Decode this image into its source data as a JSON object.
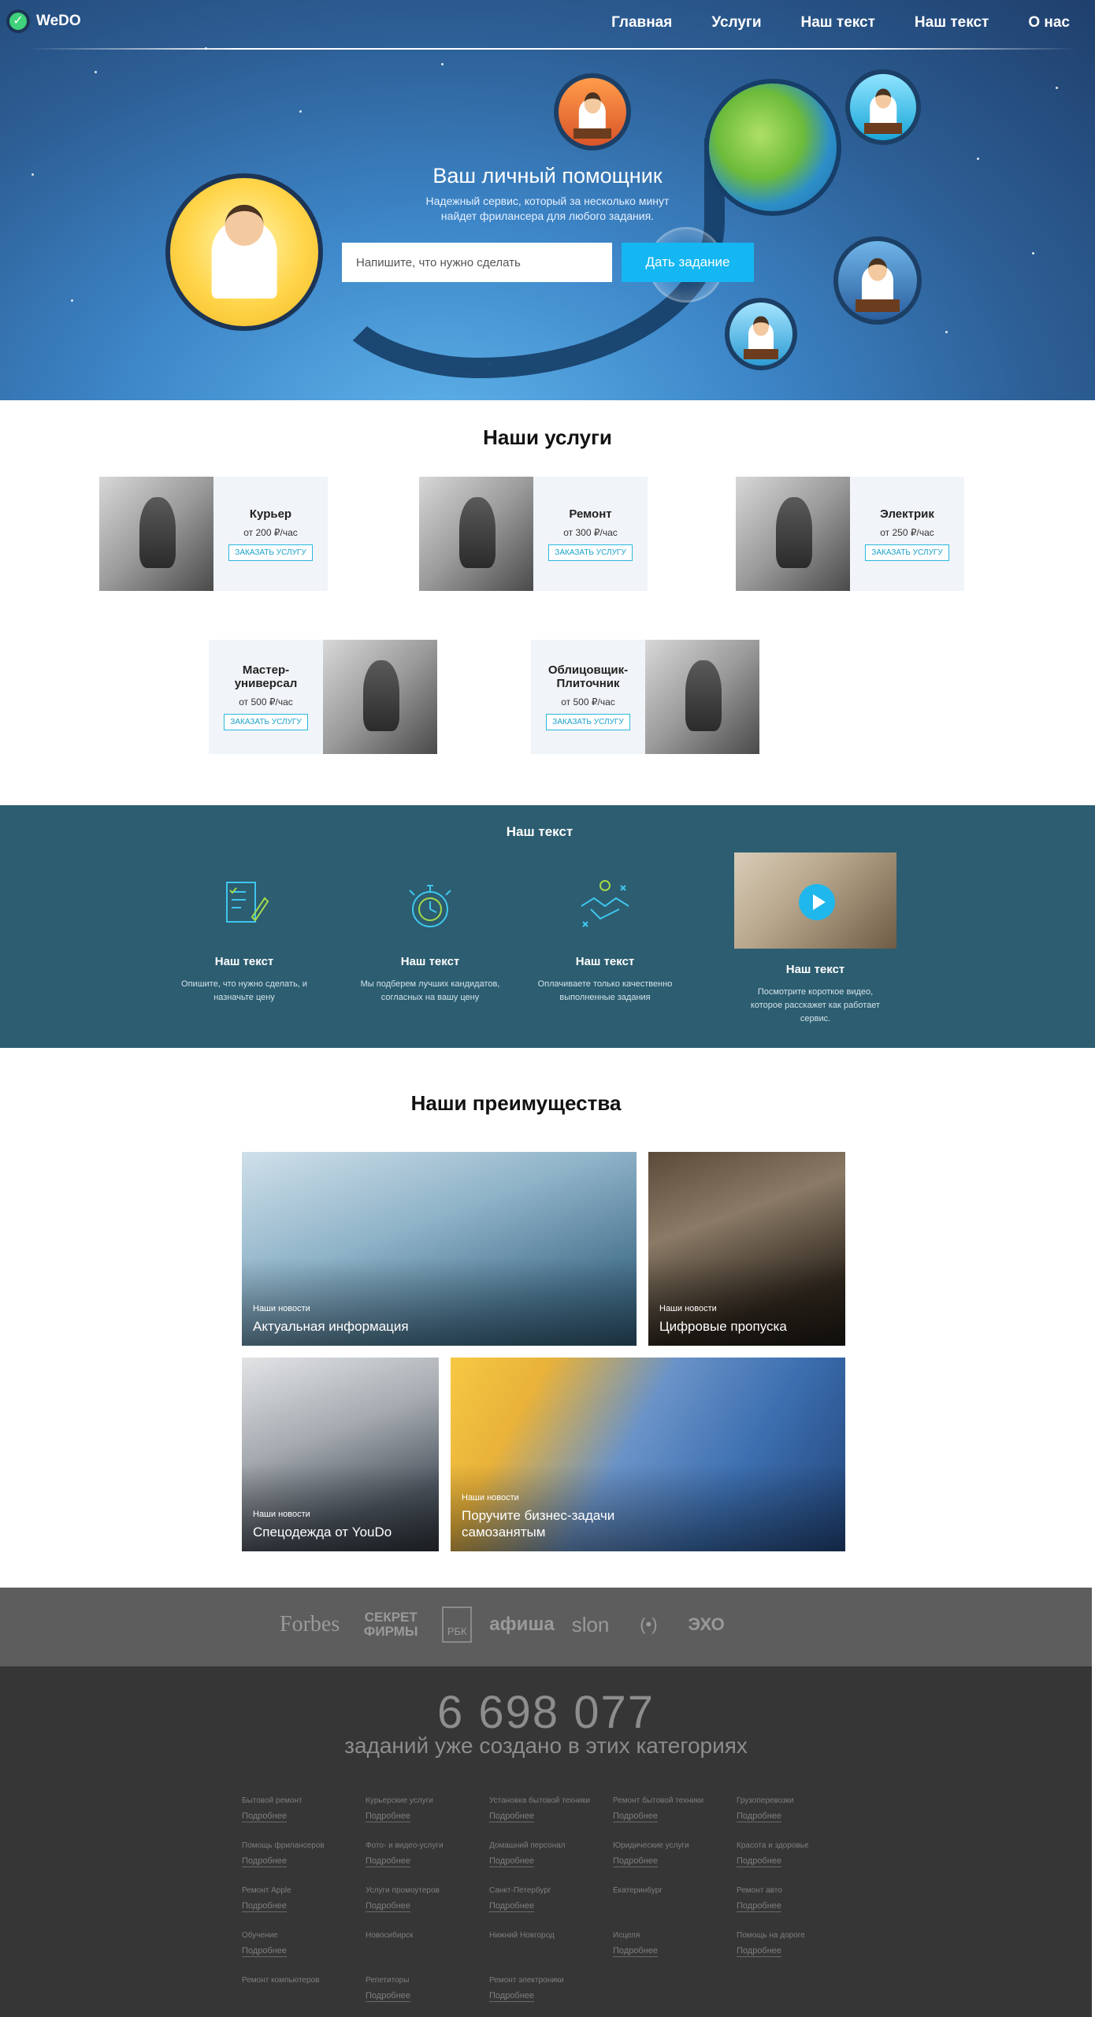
{
  "brand": {
    "name": "WeDO"
  },
  "nav": {
    "items": [
      "Главная",
      "Услуги",
      "Наш текст",
      "Наш текст",
      "О нас"
    ]
  },
  "hero": {
    "title": "Ваш личный помощник",
    "subtitle": "Надежный сервис, который за несколько минут найдет фрилансера для любого задания.",
    "input_placeholder": "Напишите, что нужно сделать",
    "button_label": "Дать задание"
  },
  "services": {
    "title": "Наши услуги",
    "order_label": "ЗАКАЗАТЬ УСЛУГУ",
    "items": [
      {
        "name": "Курьер",
        "price": "от 200 ₽/час",
        "icon": "courier-photo"
      },
      {
        "name": "Ремонт",
        "price": "от 300 ₽/час",
        "icon": "repair-photo"
      },
      {
        "name": "Электрик",
        "price": "от 250 ₽/час",
        "icon": "electrician-photo"
      },
      {
        "name": "Мастер-универсал",
        "price": "от 500 ₽/час",
        "icon": "handyman-photo"
      },
      {
        "name": "Облицовщик-Плиточник",
        "price": "от 500 ₽/час",
        "icon": "tiler-photo"
      }
    ]
  },
  "how": {
    "title": "Наш текст",
    "steps": [
      {
        "title": "Наш текст",
        "desc": "Опишите, что нужно сделать, и назначьте цену",
        "icon": "document-pen-icon"
      },
      {
        "title": "Наш текст",
        "desc": "Мы подберем лучших кандидатов, согласных на вашу цену",
        "icon": "stopwatch-icon"
      },
      {
        "title": "Наш текст",
        "desc": "Оплачиваете только качественно выполненные задания",
        "icon": "handshake-icon"
      },
      {
        "title": "Наш текст",
        "desc": "Посмотрите короткое видео, которое расскажет как работает сервис.",
        "icon": "play-icon"
      }
    ]
  },
  "advantages": {
    "title": "Наши преимущества",
    "tiles": [
      {
        "kicker": "Наши новости",
        "headline": "Актуальная информация"
      },
      {
        "kicker": "Наши новости",
        "headline": "Цифровые пропуска"
      },
      {
        "kicker": "Наши новости",
        "headline": "Спецодежда от YouDo"
      },
      {
        "kicker": "Наши новости",
        "headline": "Поручите бизнес-задачи самозанятым"
      }
    ]
  },
  "press": {
    "logos": [
      "Forbes",
      "СЕКРЕТ ФИРМЫ",
      "РБК",
      "афиша",
      "slon",
      "(•)",
      "ЭХО"
    ]
  },
  "footer": {
    "counter": "6 698 077",
    "counter_caption": "заданий уже создано в этих категориях",
    "more_label": "Подробнее",
    "categories": [
      {
        "name": "Бытовой ремонт",
        "more": true
      },
      {
        "name": "Курьерские услуги",
        "more": true
      },
      {
        "name": "Установка бытовой техники",
        "more": true
      },
      {
        "name": "Ремонт бытовой техники",
        "more": true
      },
      {
        "name": "Грузоперевозки",
        "more": true
      },
      {
        "name": "Помощь фрилансеров",
        "more": true
      },
      {
        "name": "Фото- и видео-услуги",
        "more": true
      },
      {
        "name": "Домашний персонал",
        "more": true
      },
      {
        "name": "Юридические услуги",
        "more": true
      },
      {
        "name": "Красота и здоровье",
        "more": true
      },
      {
        "name": "Ремонт Apple",
        "more": true
      },
      {
        "name": "Услуги промоутеров",
        "more": true
      },
      {
        "name": "Санкт-Петербург",
        "more": true
      },
      {
        "name": "Екатеринбург",
        "more": false
      },
      {
        "name": "Ремонт авто",
        "more": true
      },
      {
        "name": "Обучение",
        "more": true
      },
      {
        "name": "Новосибирск",
        "more": false
      },
      {
        "name": "Нижний Новгород",
        "more": false
      },
      {
        "name": "Исцеля",
        "more": true
      },
      {
        "name": "Помощь на дороге",
        "more": true
      },
      {
        "name": "Ремонт компьютеров",
        "more": false
      },
      {
        "name": "Репетиторы",
        "more": true
      },
      {
        "name": "Ремонт электроники",
        "more": true
      }
    ]
  }
}
